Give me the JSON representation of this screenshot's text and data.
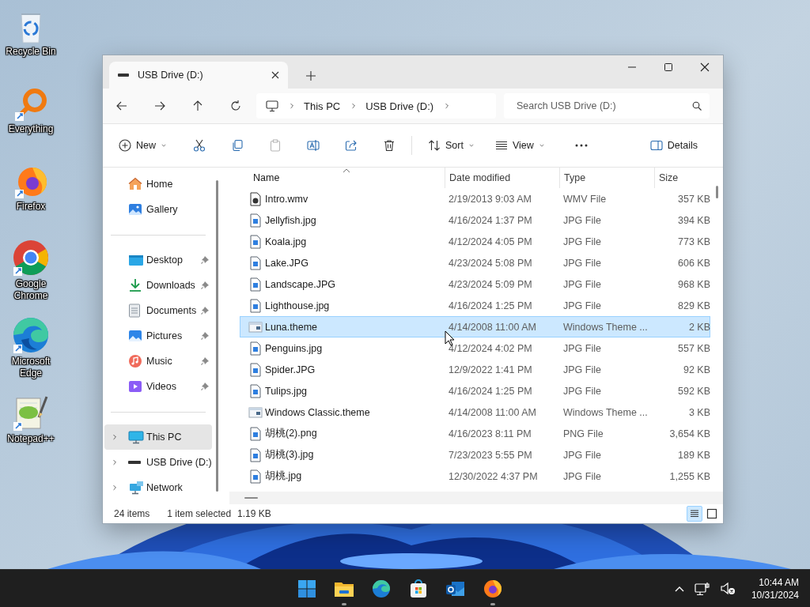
{
  "desktop_icons": [
    {
      "label": "Recycle Bin"
    },
    {
      "label": "Everything"
    },
    {
      "label": "Firefox"
    },
    {
      "label": "Google Chrome"
    },
    {
      "label": "Microsoft Edge"
    },
    {
      "label": "Notepad++"
    }
  ],
  "explorer": {
    "tab_title": "USB Drive (D:)",
    "breadcrumbs": [
      "This PC",
      "USB Drive (D:)"
    ],
    "search": {
      "placeholder": "Search USB Drive (D:)"
    },
    "toolbar": [
      {
        "kind": "menu",
        "label": "New",
        "disabled": false
      },
      {
        "kind": "icon",
        "disabled": false
      },
      {
        "kind": "icon",
        "disabled": false
      },
      {
        "kind": "icon",
        "disabled": true
      },
      {
        "kind": "icon",
        "disabled": false
      },
      {
        "kind": "icon",
        "disabled": false
      },
      {
        "kind": "icon",
        "disabled": false
      },
      {
        "kind": "menu",
        "label": "Sort",
        "disabled": false
      },
      {
        "kind": "menu",
        "label": "View",
        "disabled": false
      },
      {
        "kind": "icon",
        "disabled": false
      },
      {
        "kind": "toggle",
        "label": "Details",
        "disabled": false
      }
    ],
    "sidebar": [
      {
        "items": [
          {
            "label": "Home",
            "selected": false,
            "pinned": false
          },
          {
            "label": "Gallery",
            "selected": false,
            "pinned": false
          }
        ]
      },
      {
        "items": [
          {
            "label": "Desktop",
            "selected": false,
            "pinned": true
          },
          {
            "label": "Downloads",
            "selected": false,
            "pinned": true
          },
          {
            "label": "Documents",
            "selected": false,
            "pinned": true
          },
          {
            "label": "Pictures",
            "selected": false,
            "pinned": true
          },
          {
            "label": "Music",
            "selected": false,
            "pinned": true
          },
          {
            "label": "Videos",
            "selected": false,
            "pinned": true
          }
        ]
      },
      {
        "items": [
          {
            "label": "This PC",
            "selected": true,
            "pinned": false,
            "expanded": false
          },
          {
            "label": "USB Drive (D:)",
            "selected": false,
            "pinned": false,
            "expanded": false
          },
          {
            "label": "Network",
            "selected": false,
            "pinned": false,
            "expanded": false
          }
        ]
      }
    ],
    "columns": [
      {
        "label": "Name",
        "sorted": true
      },
      {
        "label": "Date modified",
        "sorted": false
      },
      {
        "label": "Type",
        "sorted": false
      },
      {
        "label": "Size",
        "sorted": false
      }
    ],
    "rows": [
      {
        "kind": "video",
        "name": "Intro.wmv",
        "date": "2/19/2013 9:03 AM",
        "type": "WMV File",
        "size": "357 KB",
        "selected": false
      },
      {
        "kind": "image",
        "name": "Jellyfish.jpg",
        "date": "4/16/2024 1:37 PM",
        "type": "JPG File",
        "size": "394 KB",
        "selected": false
      },
      {
        "kind": "image",
        "name": "Koala.jpg",
        "date": "4/12/2024 4:05 PM",
        "type": "JPG File",
        "size": "773 KB",
        "selected": false
      },
      {
        "kind": "image",
        "name": "Lake.JPG",
        "date": "4/23/2024 5:08 PM",
        "type": "JPG File",
        "size": "606 KB",
        "selected": false
      },
      {
        "kind": "image",
        "name": "Landscape.JPG",
        "date": "4/23/2024 5:09 PM",
        "type": "JPG File",
        "size": "968 KB",
        "selected": false
      },
      {
        "kind": "image",
        "name": "Lighthouse.jpg",
        "date": "4/16/2024 1:25 PM",
        "type": "JPG File",
        "size": "829 KB",
        "selected": false
      },
      {
        "kind": "theme",
        "name": "Luna.theme",
        "date": "4/14/2008 11:00 AM",
        "type": "Windows Theme ...",
        "size": "2 KB",
        "selected": true
      },
      {
        "kind": "image",
        "name": "Penguins.jpg",
        "date": "4/12/2024 4:02 PM",
        "type": "JPG File",
        "size": "557 KB",
        "selected": false
      },
      {
        "kind": "image",
        "name": "Spider.JPG",
        "date": "12/9/2022 1:41 PM",
        "type": "JPG File",
        "size": "92 KB",
        "selected": false
      },
      {
        "kind": "image",
        "name": "Tulips.jpg",
        "date": "4/16/2024 1:25 PM",
        "type": "JPG File",
        "size": "592 KB",
        "selected": false
      },
      {
        "kind": "theme",
        "name": "Windows Classic.theme",
        "date": "4/14/2008 11:00 AM",
        "type": "Windows Theme ...",
        "size": "3 KB",
        "selected": false
      },
      {
        "kind": "image",
        "name": "胡桃(2).png",
        "date": "4/16/2023 8:11 PM",
        "type": "PNG File",
        "size": "3,654 KB",
        "selected": false
      },
      {
        "kind": "image",
        "name": "胡桃(3).jpg",
        "date": "7/23/2023 5:55 PM",
        "type": "JPG File",
        "size": "189 KB",
        "selected": false
      },
      {
        "kind": "image",
        "name": "胡桃.jpg",
        "date": "12/30/2022 4:37 PM",
        "type": "JPG File",
        "size": "1,255 KB",
        "selected": false
      }
    ],
    "status": {
      "count": "24 items",
      "selection": "1 item selected",
      "size": "1.19 KB"
    },
    "view_buttons": [
      {
        "selected": true
      },
      {
        "selected": false
      }
    ]
  },
  "taskbar": {
    "apps": [
      {
        "running": false
      },
      {
        "running": true
      },
      {
        "running": false
      },
      {
        "running": false
      },
      {
        "running": false
      },
      {
        "running": true
      }
    ],
    "time": "10:44 AM",
    "date": "10/31/2024"
  }
}
